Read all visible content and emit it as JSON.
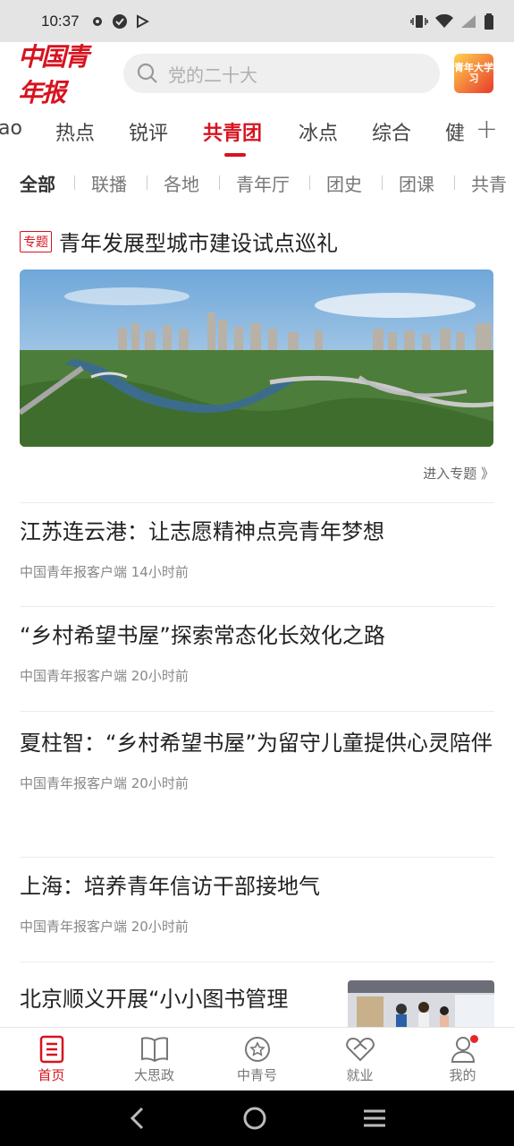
{
  "status_bar": {
    "time": "10:37",
    "left_icons": [
      "gear-icon",
      "shield-check-icon",
      "play-store-icon"
    ],
    "right_icons": [
      "vibrate-icon",
      "wifi-icon",
      "signal-icon",
      "battery-icon"
    ]
  },
  "header": {
    "logo_text": "中国青年报",
    "search_placeholder": "党的二十大",
    "study_badge": "青年大学习"
  },
  "channels": {
    "tabs": [
      "ao",
      "热点",
      "锐评",
      "共青团",
      "冰点",
      "综合",
      "健"
    ],
    "active": "共青团"
  },
  "subtabs": {
    "items": [
      "全部",
      "联播",
      "各地",
      "青年厅",
      "团史",
      "团课",
      "共青"
    ],
    "active": "全部"
  },
  "feature": {
    "tag": "专题",
    "title": "青年发展型城市建设试点巡礼",
    "enter_link": "进入专题 》"
  },
  "news": [
    {
      "title": "江苏连云港：让志愿精神点亮青年梦想",
      "meta": "中国青年报客户端 14小时前"
    },
    {
      "title": "“乡村希望书屋”探索常态化长效化之路",
      "meta": "中国青年报客户端 20小时前"
    },
    {
      "title": "夏柱智：“乡村希望书屋”为留守儿童提供心灵陪伴",
      "meta": "中国青年报客户端 20小时前"
    },
    {
      "title": "上海：培养青年信访干部接地气",
      "meta": "中国青年报客户端 20小时前"
    },
    {
      "title": "北京顺义开展“小小图书管理",
      "meta": ""
    }
  ],
  "bottom_nav": {
    "items": [
      {
        "label": "首页",
        "icon": "home-doc-icon"
      },
      {
        "label": "大思政",
        "icon": "book-icon"
      },
      {
        "label": "中青号",
        "icon": "star-badge-icon"
      },
      {
        "label": "就业",
        "icon": "heart-hands-icon"
      },
      {
        "label": "我的",
        "icon": "user-icon"
      }
    ],
    "active": "首页"
  },
  "colors": {
    "accent": "#d7131f",
    "status_bg": "#e4e4e4"
  }
}
